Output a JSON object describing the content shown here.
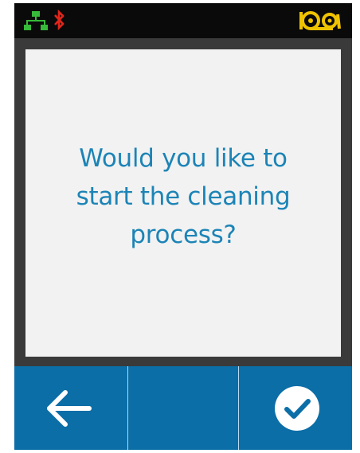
{
  "status_bar": {
    "icons": [
      "network-icon",
      "bluetooth-icon",
      "media-icon"
    ],
    "network_color": "#37b93a",
    "bluetooth_color": "#e3261b",
    "media_color": "#f0c300"
  },
  "dialog": {
    "message": "Would you like to start the cleaning process?",
    "text_color": "#1c84b6",
    "background": "#f2f2f2"
  },
  "buttons": {
    "left_icon": "back-arrow-icon",
    "middle_label": "",
    "right_icon": "check-circle-icon",
    "background": "#0b6ea7"
  }
}
